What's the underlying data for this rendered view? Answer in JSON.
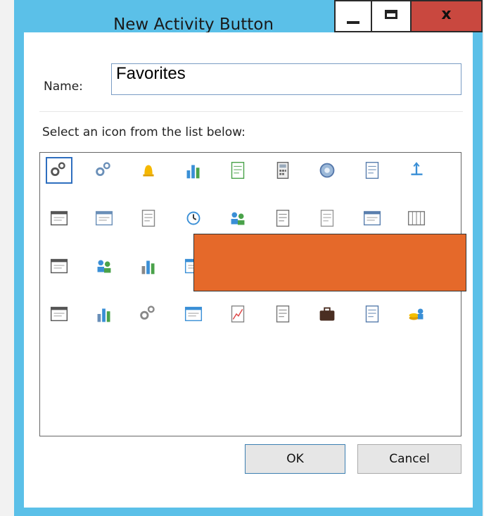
{
  "window": {
    "title": "New Activity Button",
    "controls": {
      "minimize": "minimize",
      "maximize": "maximize",
      "close": "x"
    }
  },
  "form": {
    "name_label": "Name:",
    "name_value": "Favorites",
    "select_label": "Select an icon from the list below:"
  },
  "icons": [
    "gears-icon",
    "gear-user-icon",
    "bell-icon",
    "chart-search-icon",
    "report-icon",
    "calculator-icon",
    "globe-icon",
    "document-check-icon",
    "flow-arrow-icon",
    "document-play-icon",
    "add-list-icon",
    "page-icon",
    "history-icon",
    "users-document-icon",
    "document-truck-icon",
    "wallet-icon",
    "form-icon",
    "table-columns-icon",
    "list-window-icon",
    "people-icon",
    "color-bars-icon",
    "chart-window-icon",
    "box-document-icon",
    "color-bars-icon-2",
    "text-list-icon",
    "book-icon",
    "check-window-icon",
    "grid-settings-icon",
    "bar-chart-icon",
    "gears-icon-2",
    "window-abc-icon",
    "line-chart-icon",
    "table-doc-icon",
    "briefcase-icon",
    "spreadsheet-icon",
    "coins-user-icon"
  ],
  "colors": {
    "frame": "#5bc0e8",
    "close": "#c9483f",
    "overlay": "#e5692a",
    "selection": "#2f6fbf"
  },
  "buttons": {
    "ok": "OK",
    "cancel": "Cancel"
  }
}
